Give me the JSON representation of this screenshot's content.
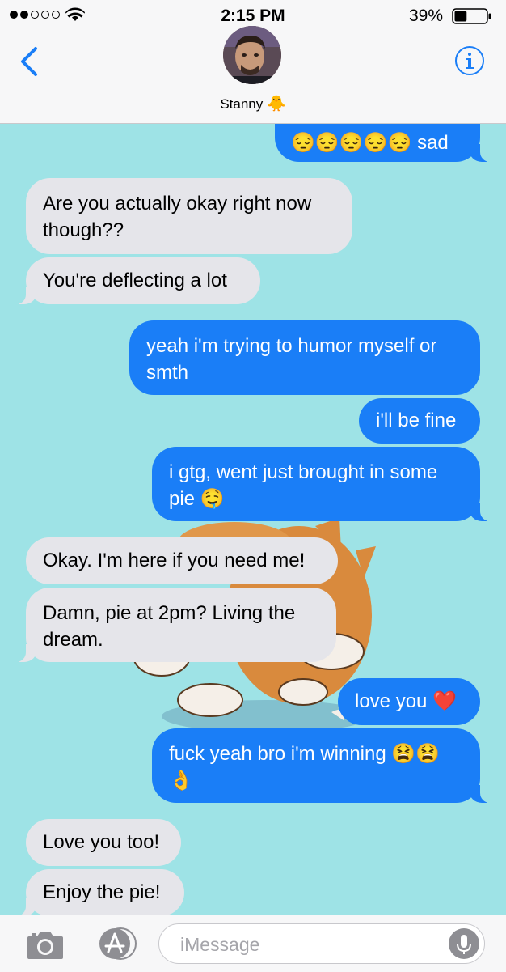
{
  "status_bar": {
    "time": "2:15 PM",
    "battery_percent": "39%",
    "signal_bars_filled": 2,
    "signal_bars_total": 5,
    "battery_level": 0.39
  },
  "header": {
    "contact_name": "Stanny",
    "contact_emoji": "🐥",
    "back_icon": "chevron-left-icon",
    "info_icon": "info-icon",
    "accent_color": "#1a7ef7"
  },
  "messages": [
    {
      "from": "me",
      "text": "😔😔😔😔😔 sad"
    },
    {
      "from": "them",
      "text": "Are you actually okay right now though??"
    },
    {
      "from": "them",
      "text": "You're deflecting a lot"
    },
    {
      "from": "me",
      "text": "yeah i'm trying to humor myself or smth"
    },
    {
      "from": "me",
      "text": "i'll be fine"
    },
    {
      "from": "me",
      "text": "i gtg, went just brought in some pie 🤤"
    },
    {
      "from": "them",
      "text": "Okay. I'm here if you need me!"
    },
    {
      "from": "them",
      "text": "Damn, pie at 2pm? Living the dream."
    },
    {
      "from": "me",
      "text": "love you ❤️"
    },
    {
      "from": "me",
      "text": "fuck yeah bro i'm winning 😫😫👌"
    },
    {
      "from": "them",
      "text": "Love you too!"
    },
    {
      "from": "them",
      "text": "Enjoy the pie!"
    }
  ],
  "sticker": {
    "icon": "shiba-dog-sticker"
  },
  "compose": {
    "placeholder": "iMessage",
    "camera_icon": "camera-icon",
    "apps_icon": "app-store-icon",
    "mic_icon": "microphone-icon"
  },
  "colors": {
    "background": "#9ee3e6",
    "incoming_bubble": "#e5e5ea",
    "outgoing_bubble": "#1a7ef7"
  }
}
